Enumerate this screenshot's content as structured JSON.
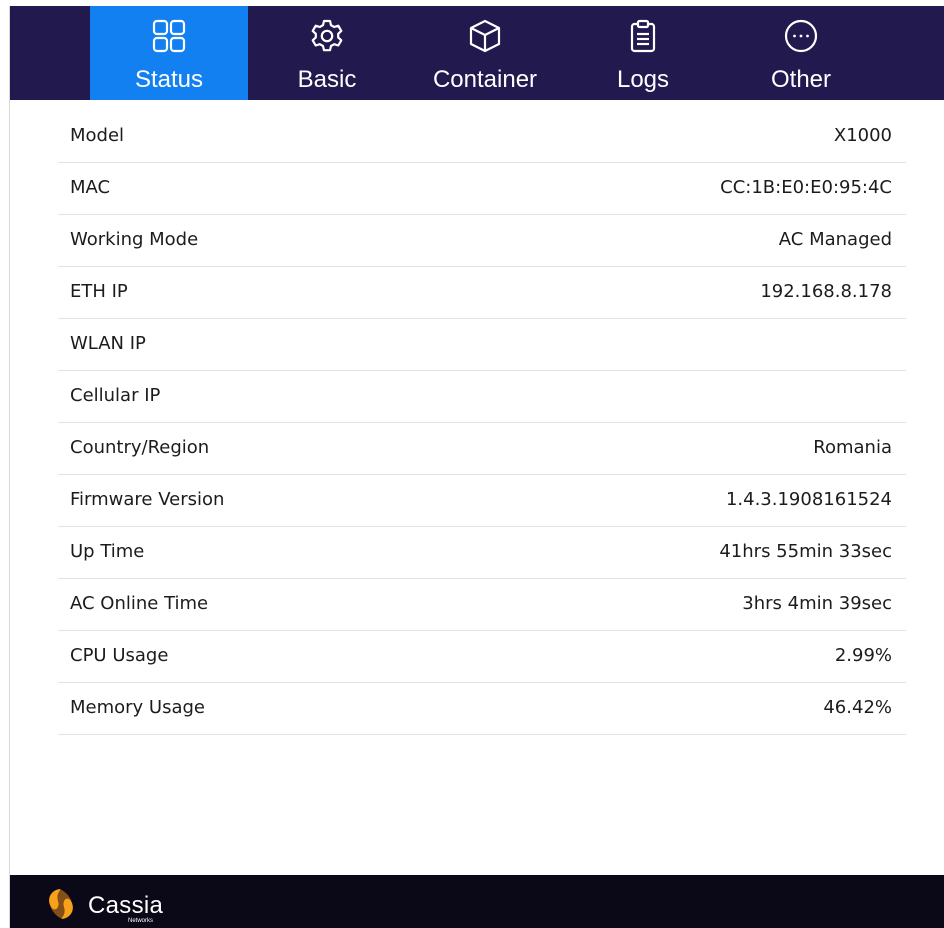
{
  "nav": {
    "tabs": [
      {
        "label": "Status",
        "icon": "grid-icon",
        "active": true
      },
      {
        "label": "Basic",
        "icon": "gear-icon",
        "active": false
      },
      {
        "label": "Container",
        "icon": "cube-icon",
        "active": false
      },
      {
        "label": "Logs",
        "icon": "clipboard-icon",
        "active": false
      },
      {
        "label": "Other",
        "icon": "more-icon",
        "active": false
      }
    ]
  },
  "status": {
    "rows": [
      {
        "key": "Model",
        "value": "X1000"
      },
      {
        "key": "MAC",
        "value": "CC:1B:E0:E0:95:4C"
      },
      {
        "key": "Working Mode",
        "value": "AC Managed"
      },
      {
        "key": "ETH IP",
        "value": "192.168.8.178"
      },
      {
        "key": "WLAN IP",
        "value": ""
      },
      {
        "key": "Cellular IP",
        "value": ""
      },
      {
        "key": "Country/Region",
        "value": "Romania"
      },
      {
        "key": "Firmware Version",
        "value": "1.4.3.1908161524"
      },
      {
        "key": "Up Time",
        "value": "41hrs 55min 33sec"
      },
      {
        "key": "AC Online Time",
        "value": "3hrs 4min 39sec"
      },
      {
        "key": "CPU Usage",
        "value": "2.99%"
      },
      {
        "key": "Memory Usage",
        "value": "46.42%"
      }
    ]
  },
  "footer": {
    "brand": "Cassia",
    "brand_sub": "Networks"
  },
  "colors": {
    "nav_bg": "#221a4e",
    "active_tab": "#1380f2",
    "footer_bg": "#0b0818",
    "logo_orange": "#f7a21b"
  }
}
